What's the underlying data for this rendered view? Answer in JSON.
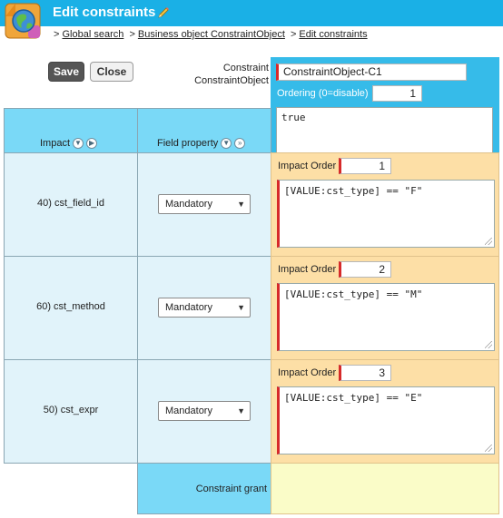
{
  "header": {
    "title": "Edit constraints"
  },
  "breadcrumb": {
    "prefix": ">",
    "items": [
      "Global search",
      "Business object ConstraintObject",
      "Edit constraints"
    ],
    "sep": ">"
  },
  "toolbar": {
    "save_label": "Save",
    "close_label": "Close"
  },
  "constraint": {
    "label_line1": "Constraint",
    "label_line2": "ConstraintObject",
    "name_value": "ConstraintObject-C1",
    "ordering_label": "Ordering (0=disable)",
    "ordering_value": "1",
    "expression": "true"
  },
  "table": {
    "col_impact": "Impact",
    "col_field_property": "Field property",
    "rows": [
      {
        "impact": "40) cst_field_id",
        "property": "Mandatory",
        "order_label": "Impact Order",
        "order": "1",
        "expression": "[VALUE:cst_type] == \"F\""
      },
      {
        "impact": "60) cst_method",
        "property": "Mandatory",
        "order_label": "Impact Order",
        "order": "2",
        "expression": "[VALUE:cst_type] == \"M\""
      },
      {
        "impact": "50) cst_expr",
        "property": "Mandatory",
        "order_label": "Impact Order",
        "order": "3",
        "expression": "[VALUE:cst_type] == \"E\""
      }
    ],
    "grant_label": "Constraint grant"
  },
  "colors": {
    "header_blue": "#1ab0e6",
    "panel_blue": "#36bbe9",
    "header_cell": "#7ad9f7",
    "row_cell": "#e1f3fa",
    "orange_cell": "#fddfa6",
    "grant_cell": "#fafcc8",
    "required_marker": "#d62a2a"
  }
}
